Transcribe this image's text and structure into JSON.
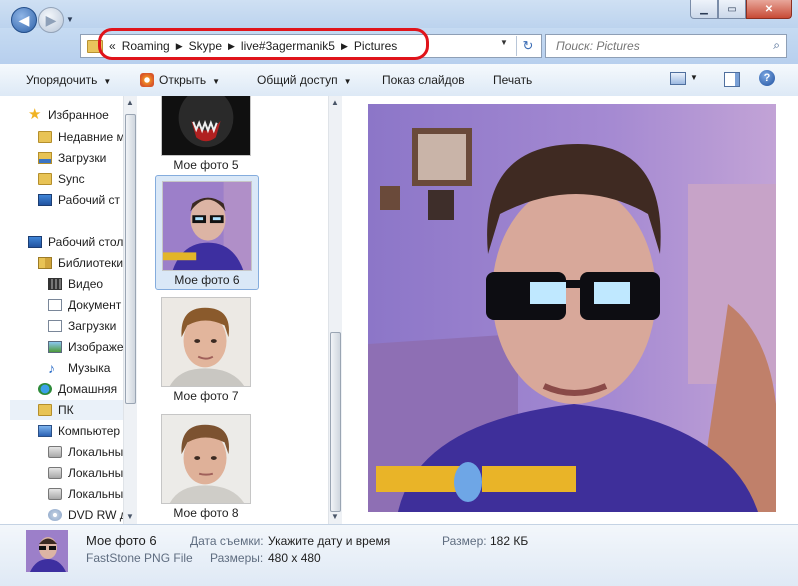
{
  "window": {
    "minimize_icon": "minimize-icon",
    "maximize_icon": "maximize-icon",
    "close_icon": "close-icon"
  },
  "nav": {
    "breadcrumb_overflow": "«",
    "breadcrumbs": [
      "Roaming",
      "Skype",
      "live#3agermanik5",
      "Pictures"
    ],
    "search_placeholder": "Поиск: Pictures",
    "annotation_color": "#e0141b"
  },
  "toolbar": {
    "organize": "Упорядочить",
    "open": "Открыть",
    "share": "Общий доступ",
    "slideshow": "Показ слайдов",
    "print": "Печать",
    "help": "?"
  },
  "sidebar": {
    "items": [
      {
        "label": "Избранное",
        "icon": "star-icon"
      },
      {
        "label": "Недавние м",
        "icon": "recent-places-icon"
      },
      {
        "label": "Загрузки",
        "icon": "downloads-folder-icon"
      },
      {
        "label": "Sync",
        "icon": "folder-icon"
      },
      {
        "label": "Рабочий ст",
        "icon": "desktop-icon"
      },
      {
        "label": "Рабочий стол",
        "icon": "desktop-icon"
      },
      {
        "label": "Библиотеки",
        "icon": "libraries-icon"
      },
      {
        "label": "Видео",
        "icon": "video-library-icon"
      },
      {
        "label": "Документ",
        "icon": "documents-library-icon"
      },
      {
        "label": "Загрузки",
        "icon": "downloads-library-icon"
      },
      {
        "label": "Изображе",
        "icon": "pictures-library-icon"
      },
      {
        "label": "Музыка",
        "icon": "music-icon"
      },
      {
        "label": "Домашняя",
        "icon": "homegroup-icon"
      },
      {
        "label": "ПК",
        "icon": "folder-icon"
      },
      {
        "label": "Компьютер",
        "icon": "computer-icon"
      },
      {
        "label": "Локальны",
        "icon": "local-disk-icon"
      },
      {
        "label": "Локальны",
        "icon": "local-disk-icon"
      },
      {
        "label": "Локальны",
        "icon": "local-disk-icon"
      },
      {
        "label": "DVD RW д",
        "icon": "dvd-drive-icon"
      }
    ]
  },
  "files": [
    {
      "name": "Мое фото 5",
      "selected": false
    },
    {
      "name": "Мое фото 6",
      "selected": true
    },
    {
      "name": "Мое фото 7",
      "selected": false
    },
    {
      "name": "Мое фото 8",
      "selected": false
    }
  ],
  "details": {
    "name": "Мое фото 6",
    "type": "FastStone PNG File",
    "date_label": "Дата съемки:",
    "date_value": "Укажите дату и время",
    "size_label": "Размер:",
    "size_value": "182 КБ",
    "dims_label": "Размеры:",
    "dims_value": "480 x 480"
  }
}
